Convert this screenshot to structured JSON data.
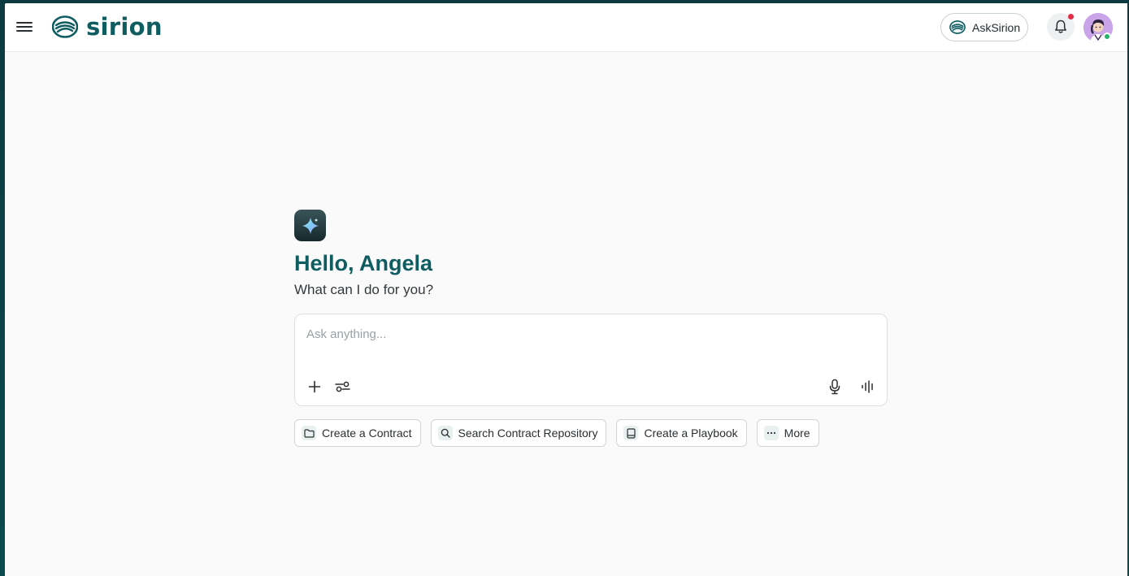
{
  "brand": {
    "name": "sirion",
    "color": "#0f5c61"
  },
  "header": {
    "ask_button_label": "AskSirion",
    "icons": [
      "menu-icon",
      "bell-icon",
      "user-avatar"
    ]
  },
  "main": {
    "greeting": "Hello, Angela",
    "subtitle": "What can I do for you?",
    "composer": {
      "placeholder": "Ask anything...",
      "value": ""
    }
  },
  "chips": [
    {
      "label": "Create a Contract",
      "icon": "folder-icon"
    },
    {
      "label": "Search Contract Repository",
      "icon": "search-icon"
    },
    {
      "label": "Create a Playbook",
      "icon": "book-icon"
    },
    {
      "label": "More",
      "icon": "more-icon"
    }
  ],
  "colors": {
    "accent": "#0f5c61",
    "notification": "#e52b45",
    "online": "#22b36a"
  }
}
